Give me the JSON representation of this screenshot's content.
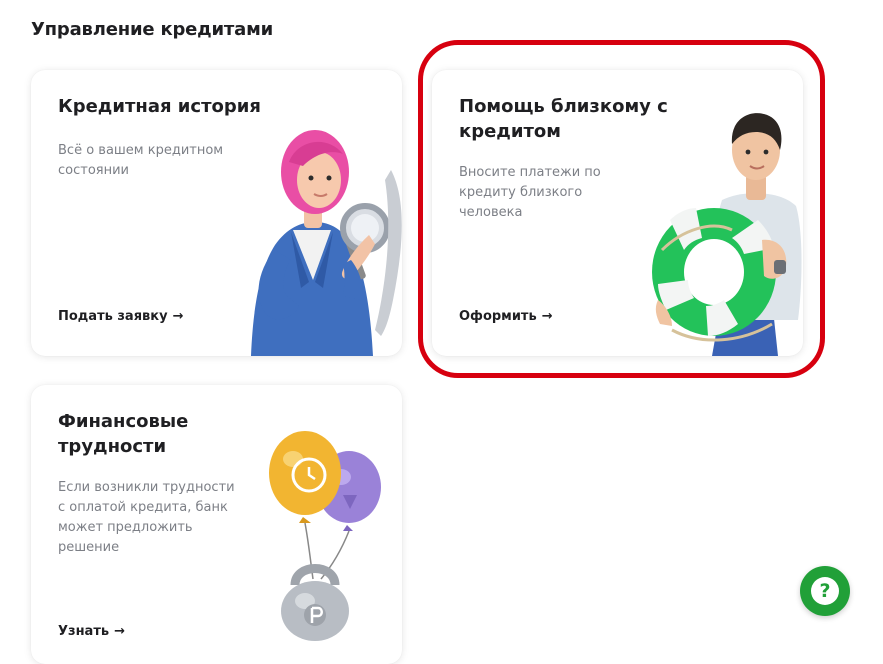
{
  "section": {
    "title": "Управление кредитами"
  },
  "cards": [
    {
      "title": "Кредитная история",
      "description": "Всё о вашем кредитном состоянии",
      "link": "Подать заявку",
      "arrow": "→",
      "illustration": "woman-with-magnifier-icon"
    },
    {
      "title": "Помощь близкому с кредитом",
      "description": "Вносите платежи по кредиту близкого человека",
      "link": "Оформить",
      "arrow": "→",
      "illustration": "man-with-lifebuoy-icon",
      "highlighted": true
    },
    {
      "title": "Финансовые трудности",
      "description": "Если возникли трудности с оплатой кредита, банк может предложить решение",
      "link": "Узнать",
      "arrow": "→",
      "illustration": "balloons-kettlebell-icon"
    }
  ],
  "help": {
    "label": "?",
    "icon": "question-icon"
  },
  "colors": {
    "brand": "#21a038",
    "highlight": "#d7000f",
    "text": "#1f1f22",
    "muted": "#7c7f86"
  }
}
